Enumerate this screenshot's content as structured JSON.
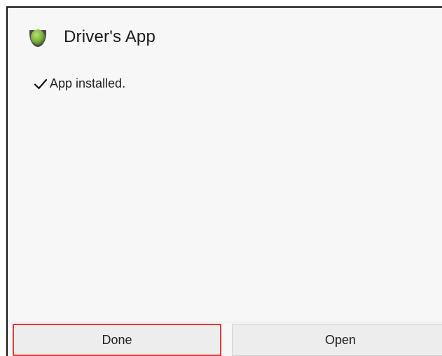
{
  "dialog": {
    "app_name": "Driver's App",
    "app_icon": "green-dome-app-icon",
    "status_icon": "checkmark-icon",
    "status_text": "App installed."
  },
  "buttons": {
    "done_label": "Done",
    "open_label": "Open"
  },
  "colors": {
    "background": "#f7f7f7",
    "highlight_border": "#e53935",
    "icon_green": "#7cb342"
  }
}
